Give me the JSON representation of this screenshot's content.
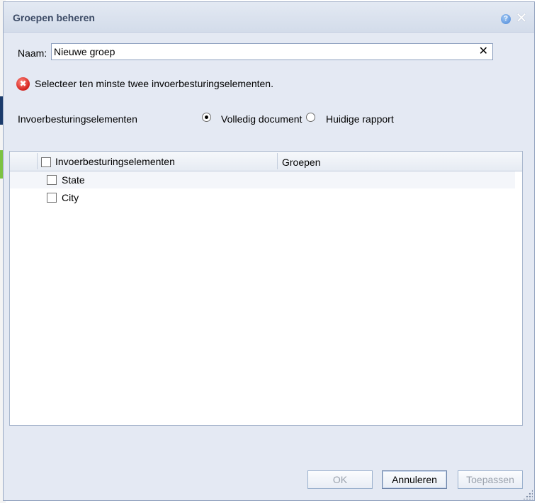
{
  "dialog": {
    "title": "Groepen beheren",
    "help_icon": "help-icon",
    "close_icon": "close-icon"
  },
  "name_field": {
    "label": "Naam:",
    "value": "Nieuwe groep",
    "clear_icon": "clear-icon"
  },
  "error": {
    "icon": "error-icon",
    "message": "Selecteer ten minste twee invoerbesturingselementen."
  },
  "controls_scope": {
    "label": "Invoerbesturingselementen",
    "options": [
      {
        "label": "Volledig document",
        "selected": true
      },
      {
        "label": "Huidige rapport",
        "selected": false
      }
    ]
  },
  "grid": {
    "columns": [
      "Invoerbesturingselementen",
      "Groepen"
    ],
    "rows": [
      {
        "label": "State",
        "checked": false
      },
      {
        "label": "City",
        "checked": false
      }
    ]
  },
  "buttons": {
    "ok": "OK",
    "cancel": "Annuleren",
    "apply": "Toepassen"
  },
  "colors": {
    "dialog_bg": "#e4e9f3",
    "title_text": "#3c4b66",
    "error_red": "#d4201b",
    "disabled_text": "#9aa2ad"
  }
}
